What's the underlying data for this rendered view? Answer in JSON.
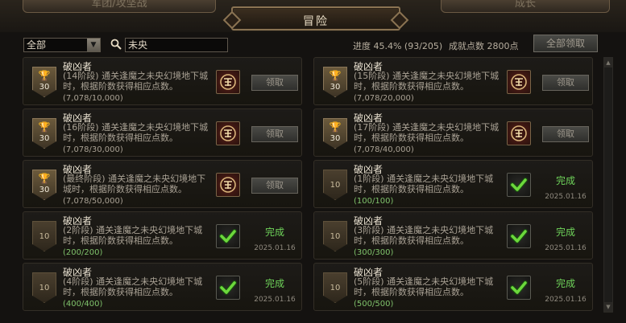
{
  "tabs": {
    "left": "军团/攻坚战",
    "center": "冒险",
    "right": "成长"
  },
  "filter": {
    "category": "全部",
    "search_value": "未央"
  },
  "summary": {
    "progress": "进度 45.4% (93/205)",
    "points": "成就点数 2800点",
    "claim_all": "全部领取"
  },
  "achievements": [
    {
      "title": "破凶者",
      "desc": "(14阶段) 通关逢魔之未央幻境地下城时，根据阶数获得相应点数。",
      "progress": "(7,078/10,000)",
      "points": "30",
      "status": "claim",
      "button": "领取",
      "date": ""
    },
    {
      "title": "破凶者",
      "desc": "(15阶段) 通关逢魔之未央幻境地下城时，根据阶数获得相应点数。",
      "progress": "(7,078/20,000)",
      "points": "30",
      "status": "claim",
      "button": "领取",
      "date": ""
    },
    {
      "title": "破凶者",
      "desc": "(16阶段) 通关逢魔之未央幻境地下城时，根据阶数获得相应点数。",
      "progress": "(7,078/30,000)",
      "points": "30",
      "status": "claim",
      "button": "领取",
      "date": ""
    },
    {
      "title": "破凶者",
      "desc": "(17阶段) 通关逢魔之未央幻境地下城时，根据阶数获得相应点数。",
      "progress": "(7,078/40,000)",
      "points": "30",
      "status": "claim",
      "button": "领取",
      "date": ""
    },
    {
      "title": "破凶者",
      "desc": "(最终阶段) 通关逢魔之未央幻境地下城时，根据阶数获得相应点数。",
      "progress": "(7,078/50,000)",
      "points": "30",
      "status": "claim",
      "button": "领取",
      "date": ""
    },
    {
      "title": "破凶者",
      "desc": "(1阶段) 通关逢魔之未央幻境地下城时，根据阶数获得相应点数。",
      "progress": "(100/100)",
      "points": "10",
      "status": "done",
      "button": "完成",
      "date": "2025.01.16"
    },
    {
      "title": "破凶者",
      "desc": "(2阶段) 通关逢魔之未央幻境地下城时，根据阶数获得相应点数。",
      "progress": "(200/200)",
      "points": "10",
      "status": "done",
      "button": "完成",
      "date": "2025.01.16"
    },
    {
      "title": "破凶者",
      "desc": "(3阶段) 通关逢魔之未央幻境地下城时，根据阶数获得相应点数。",
      "progress": "(300/300)",
      "points": "10",
      "status": "done",
      "button": "完成",
      "date": "2025.01.16"
    },
    {
      "title": "破凶者",
      "desc": "(4阶段) 通关逢魔之未央幻境地下城时，根据阶数获得相应点数。",
      "progress": "(400/400)",
      "points": "10",
      "status": "done",
      "button": "完成",
      "date": "2025.01.16"
    },
    {
      "title": "破凶者",
      "desc": "(5阶段) 通关逢魔之未央幻境地下城时，根据阶数获得相应点数。",
      "progress": "(500/500)",
      "points": "10",
      "status": "done",
      "button": "完成",
      "date": "2025.01.16"
    }
  ],
  "colors": {
    "done": "#6fd45a",
    "accent": "#8a7352"
  }
}
